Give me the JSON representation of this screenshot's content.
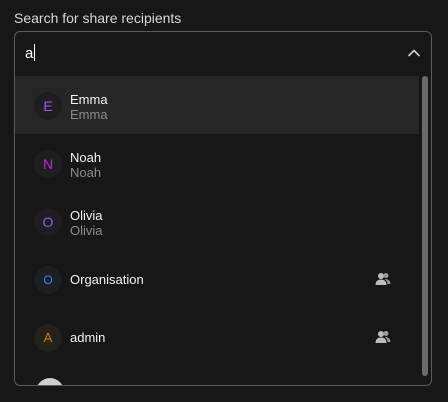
{
  "field_label": "Search for share recipients",
  "search": {
    "value": "a"
  },
  "colors": {
    "background": "#171717",
    "selected_row": "#262626",
    "border": "#5c5c5c"
  },
  "recipients": [
    {
      "initial": "E",
      "name": "Emma",
      "subtitle": "Emma",
      "color": "#a855f7",
      "selected": true
    },
    {
      "initial": "N",
      "name": "Noah",
      "subtitle": "Noah",
      "color": "#c026d3"
    },
    {
      "initial": "O",
      "name": "Olivia",
      "subtitle": "Olivia",
      "color": "#8b5cf6"
    },
    {
      "initial": "O",
      "name": "Organisation",
      "color": "#3b82f6",
      "icon": "group-icon"
    },
    {
      "initial": "A",
      "name": "admin",
      "color": "#d97706",
      "icon": "group-icon"
    }
  ],
  "icons": {
    "toggle": "chevron-up-icon",
    "group": "group-icon"
  }
}
